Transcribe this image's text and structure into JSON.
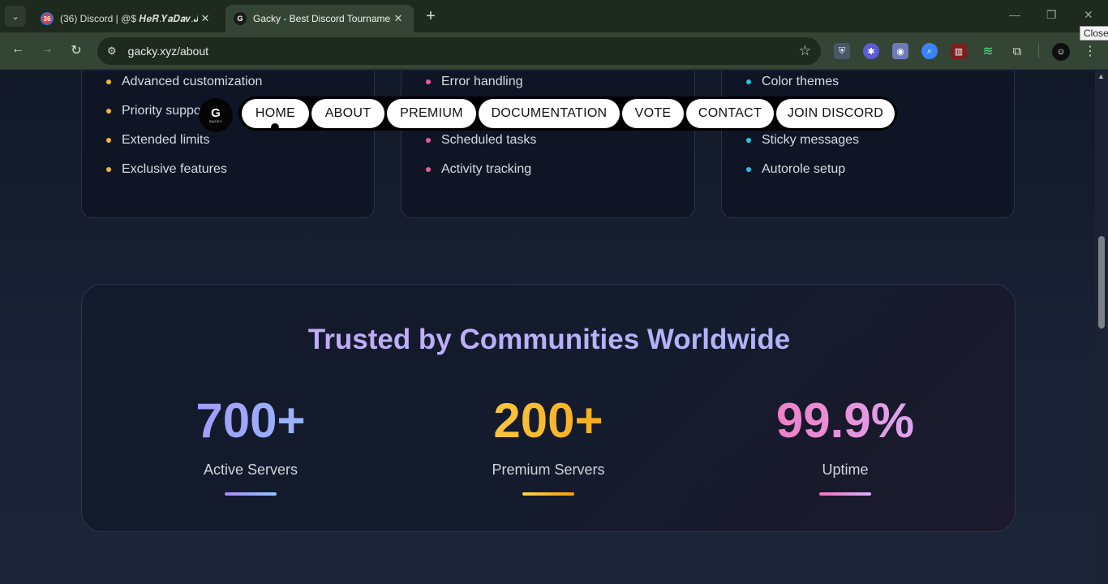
{
  "browser": {
    "tabs": [
      {
        "title": "(36) Discord | @$ 𝑯𝒆𝑹.𝒀𝒂𝑫𝒂𝒗.𝑱",
        "badge": "36"
      },
      {
        "title": "Gacky - Best Discord Tournament",
        "badge": "G"
      }
    ],
    "new_tab": "+",
    "url": "gacky.xyz/about",
    "tooltip": "Close",
    "minimize": "—",
    "restore": "❐",
    "close": "✕"
  },
  "features": {
    "col1": [
      "Advanced customization",
      "Priority support",
      "Extended limits",
      "Exclusive features"
    ],
    "col2": [
      "Error handling",
      "Scheduled tasks",
      "Activity tracking"
    ],
    "col3": [
      "Color themes",
      "Sticky messages",
      "Autorole setup"
    ]
  },
  "nav": {
    "logo_letter": "G",
    "logo_word": "GACKY",
    "items": [
      "HOME",
      "ABOUT",
      "PREMIUM",
      "DOCUMENTATION",
      "VOTE",
      "CONTACT",
      "JOIN DISCORD"
    ]
  },
  "stats": {
    "title": "Trusted by Communities Worldwide",
    "items": [
      {
        "value": "700+",
        "label": "Active Servers",
        "colors": [
          "#a78bfa",
          "#93c5fd"
        ]
      },
      {
        "value": "200+",
        "label": "Premium Servers",
        "colors": [
          "#fcd34d",
          "#f59e0b"
        ]
      },
      {
        "value": "99.9%",
        "label": "Uptime",
        "colors": [
          "#f472b6",
          "#d8b4fe"
        ]
      }
    ]
  }
}
